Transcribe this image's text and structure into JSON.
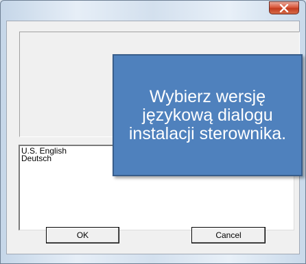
{
  "window": {
    "title": "",
    "close_icon": "close-x-icon"
  },
  "language_list": {
    "items": [
      {
        "label": "U.S. English"
      },
      {
        "label": "Deutsch"
      }
    ]
  },
  "buttons": {
    "ok_label": "OK",
    "cancel_label": "Cancel"
  },
  "callout": {
    "text": "Wybierz wersję językową dialogu instalacji sterownika.",
    "color": "#4f81bd"
  }
}
